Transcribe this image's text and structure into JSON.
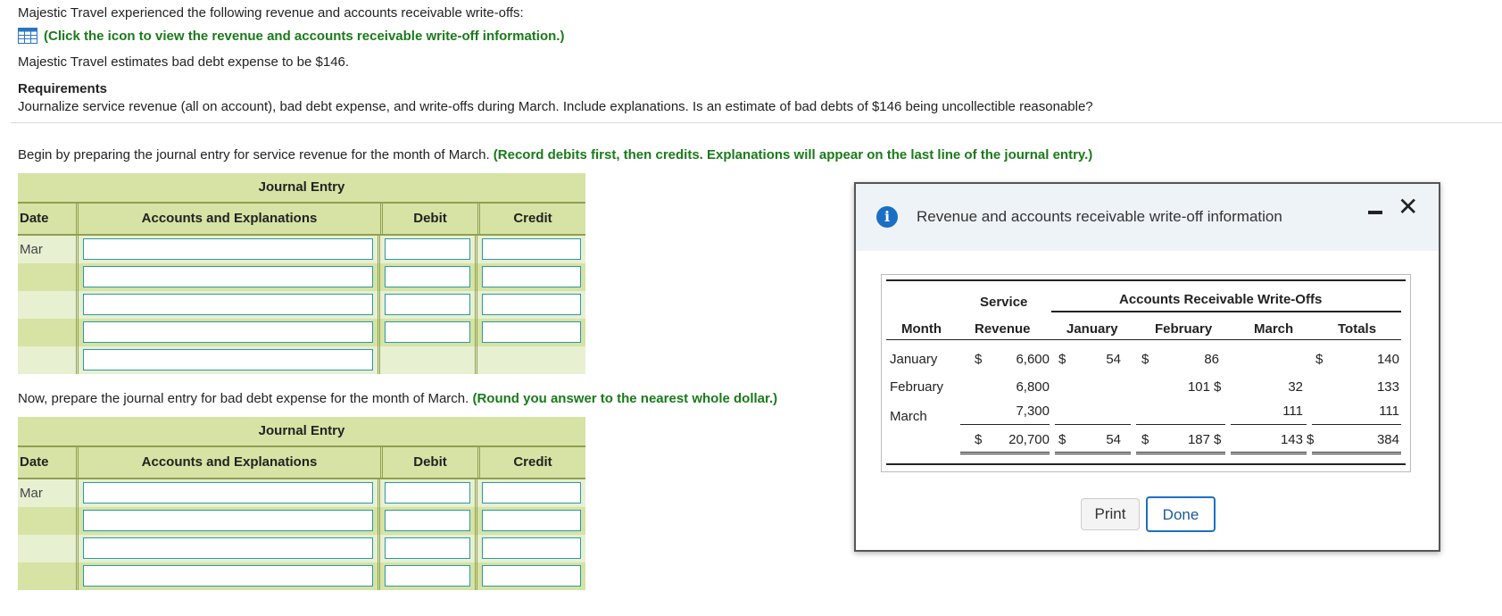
{
  "intro": {
    "line1": "Majestic Travel experienced the following revenue and accounts receivable write-offs:",
    "link": "(Click the icon to view the revenue and accounts receivable write-off information.)",
    "line3": "Majestic Travel estimates bad debt expense to be $146."
  },
  "requirements": {
    "heading": "Requirements",
    "text": "Journalize service revenue (all on account), bad debt expense, and write-offs during March. Include explanations. Is an estimate of bad debts of $146 being uncollectible reasonable?"
  },
  "step1": {
    "text": "Begin by preparing the journal entry for service revenue for the month of March.",
    "hint": "(Record debits first, then credits. Explanations will appear on the last line of the journal entry.)"
  },
  "step2": {
    "text": "Now, prepare the journal entry for bad debt expense for the month of March.",
    "hint": "(Round you answer to the nearest whole dollar.)"
  },
  "journal": {
    "title": "Journal Entry",
    "col_date": "Date",
    "col_accounts": "Accounts and Explanations",
    "col_debit": "Debit",
    "col_credit": "Credit",
    "date_value": "Mar"
  },
  "dialog": {
    "title": "Revenue and accounts receivable write-off information",
    "print_label": "Print",
    "done_label": "Done",
    "table": {
      "head_service": "Service",
      "head_ar": "Accounts Receivable Write-Offs",
      "col_month": "Month",
      "col_revenue": "Revenue",
      "col_january": "January",
      "col_february": "February",
      "col_march": "March",
      "col_totals": "Totals",
      "currency": "$",
      "rows": [
        {
          "month": "January",
          "revenue": "6,600",
          "jan": "54",
          "feb": "86",
          "mar": "",
          "total": "140"
        },
        {
          "month": "February",
          "revenue": "6,800",
          "jan": "",
          "feb": "101",
          "mar": "32",
          "total": "133"
        },
        {
          "month": "March",
          "revenue": "7,300",
          "jan": "",
          "feb": "",
          "mar": "111",
          "total": "111"
        }
      ],
      "totals": {
        "revenue": "20,700",
        "jan": "54",
        "feb": "187",
        "mar": "143",
        "total": "384"
      }
    }
  },
  "colors": {
    "accent_green": "#1a7a1a",
    "table_header": "#d6e3a4",
    "table_row_light": "#e8f0d2",
    "input_border": "#2a9aa6",
    "info_blue": "#1a6fc4"
  }
}
